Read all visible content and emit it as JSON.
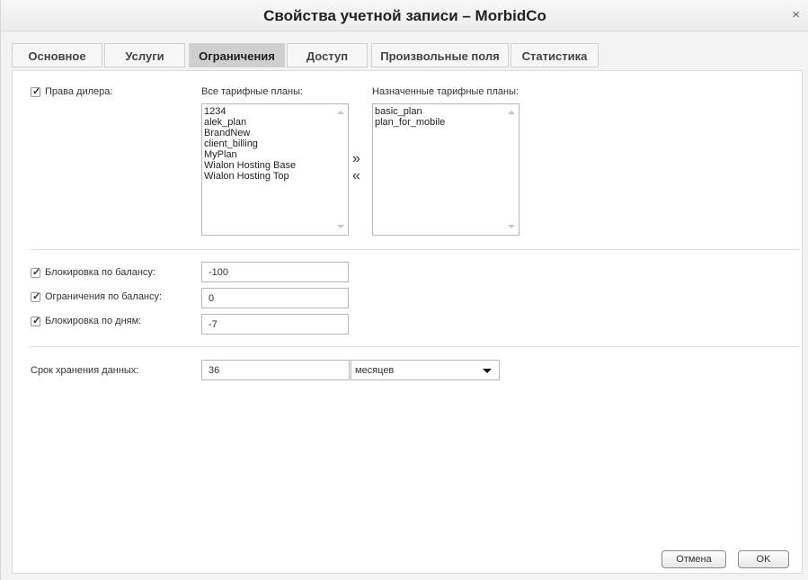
{
  "window": {
    "title": "Свойства учетной записи – MorbidCo",
    "close_glyph": "×"
  },
  "tabs": [
    {
      "label": "Основное",
      "active": false
    },
    {
      "label": "Услуги",
      "active": false
    },
    {
      "label": "Ограничения",
      "active": true
    },
    {
      "label": "Доступ",
      "active": false
    },
    {
      "label": "Произвольные поля",
      "active": false
    },
    {
      "label": "Статистика",
      "active": false
    }
  ],
  "dealer": {
    "checkbox_label": "Права дилера:",
    "checked": true
  },
  "all_plans": {
    "label": "Все тарифные планы:",
    "items": [
      "1234",
      "alek_plan",
      "BrandNew",
      "client_billing",
      "MyPlan",
      "Wialon Hosting Base",
      "Wialon Hosting Top"
    ]
  },
  "transfer": {
    "add": "»",
    "remove": "«"
  },
  "assigned_plans": {
    "label": "Назначенные тарифные планы:",
    "items": [
      "basic_plan",
      "plan_for_mobile"
    ]
  },
  "limits": [
    {
      "label": "Блокировка по балансу:",
      "checked": true,
      "value": "-100"
    },
    {
      "label": "Ограничения по балансу:",
      "checked": true,
      "value": "0"
    },
    {
      "label": "Блокировка по дням:",
      "checked": true,
      "value": "-7"
    }
  ],
  "storage": {
    "label": "Срок хранения данных:",
    "value": "36",
    "unit": "месяцев"
  },
  "footer": {
    "cancel": "Отмена",
    "ok": "OK"
  }
}
